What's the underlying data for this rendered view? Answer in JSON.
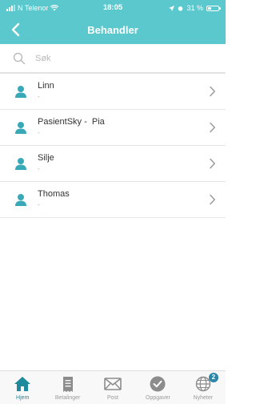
{
  "status_bar": {
    "carrier": "N Telenor",
    "time": "18:05",
    "battery": "31 %",
    "battery_level": 0.31
  },
  "header": {
    "title": "Behandler",
    "back_icon": "chevron-left-icon"
  },
  "search": {
    "placeholder": "Søk",
    "value": ""
  },
  "practitioners": [
    {
      "name": "Linn",
      "detail": "-"
    },
    {
      "name": "PasientSky -  Pia",
      "detail": "-"
    },
    {
      "name": "Silje",
      "detail": "-"
    },
    {
      "name": "Thomas",
      "detail": "-"
    }
  ],
  "tabs": [
    {
      "label": "Hjem",
      "icon": "home-icon",
      "active": true
    },
    {
      "label": "Betalinger",
      "icon": "receipt-icon",
      "active": false
    },
    {
      "label": "Post",
      "icon": "envelope-icon",
      "active": false
    },
    {
      "label": "Oppgaver",
      "icon": "checkmark-circle-icon",
      "active": false
    },
    {
      "label": "Nyheter",
      "icon": "globe-icon",
      "active": false,
      "badge": "2"
    }
  ],
  "colors": {
    "primary": "#5bc8cd",
    "active_tab": "#1f8a9c",
    "avatar": "#3aa9b7",
    "badge": "#2b86a8"
  }
}
